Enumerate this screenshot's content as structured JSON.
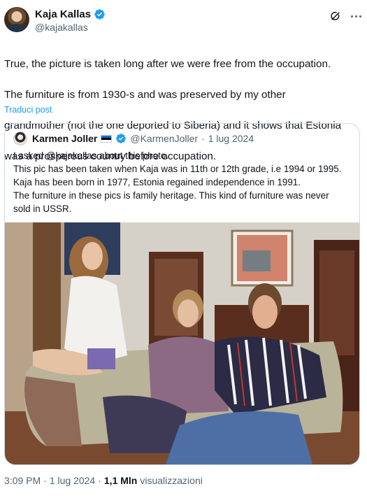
{
  "author": {
    "display_name": "Kaja Kallas",
    "handle": "@kajakallas",
    "verified_color": "#1d9bf0"
  },
  "tweet": {
    "lines": [
      "True, the picture is taken long after we were free from the occupation.",
      "The furniture is from 1930-s and was preserved by my other",
      "grandmother (not the one deported to Siberia) and it shows that Estonia",
      "was a prosperous country before occupation."
    ],
    "translate_label": "Traduci post"
  },
  "quoted": {
    "display_name": "Karmen Joller",
    "flag": "estonia-flag",
    "handle": "@KarmenJoller",
    "separator": "·",
    "date": "1 lug 2024",
    "lines": [
      "I asked @kajakallas about this photo.",
      "This pic has been taken when Kaja was in 11th or 12th grade, i.e 1994 or 1995.",
      "Kaja has been born in 1977, Estonia regained independence in 1991.",
      "The furniture in these pics is family heritage. This kind of furniture was never",
      "sold in USSR."
    ]
  },
  "meta": {
    "time": "3:09 PM",
    "separator1": "·",
    "date": "1 lug 2024",
    "separator2": "·",
    "views_count": "1,1 Mln",
    "views_label": "visualizzazioni"
  },
  "icons": {
    "grok": "grok-icon",
    "more": "more-icon",
    "verified": "verified-badge-icon"
  },
  "colors": {
    "link": "#1d9bf0",
    "secondary_text": "#536471",
    "border": "#cfd9de"
  }
}
